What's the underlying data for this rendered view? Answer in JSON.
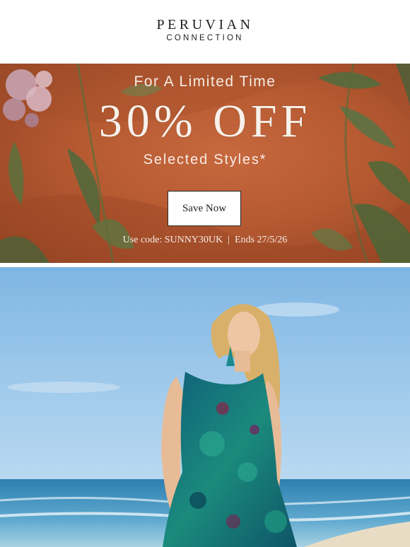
{
  "header": {
    "brand_main": "PERUVIAN",
    "brand_sub": "CONNECTION"
  },
  "promo": {
    "line1": "For A Limited Time",
    "headline": "30% OFF",
    "line2": "Selected Styles*",
    "cta_label": "Save Now",
    "code_label": "Use code:",
    "code": "SUNNY30UK",
    "separator": "|",
    "ends": "Ends 27/5/26",
    "background_color": "#b65a32"
  },
  "hero_image": {
    "icon": "model-beach-photo"
  }
}
